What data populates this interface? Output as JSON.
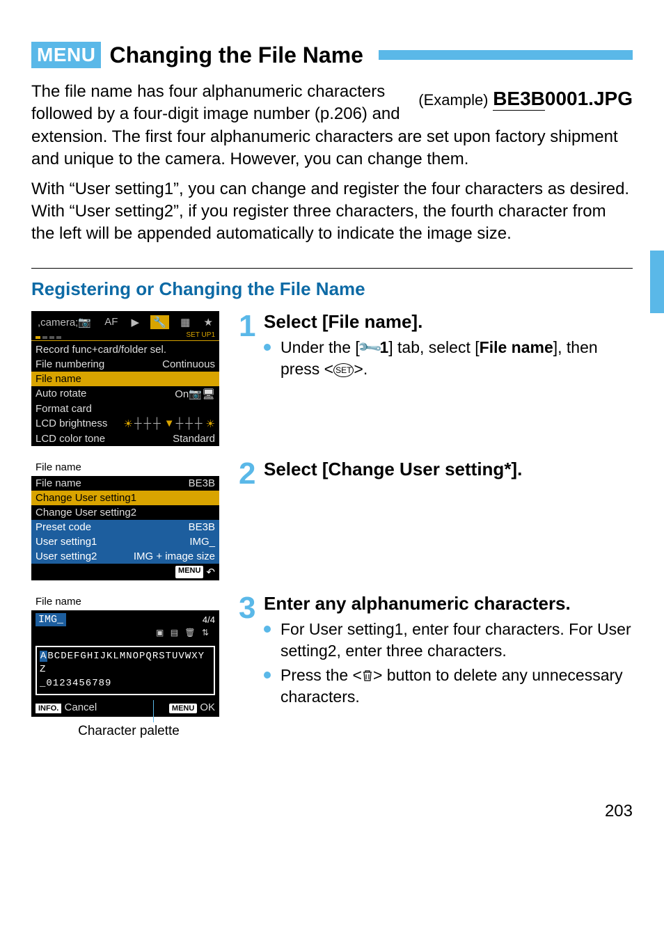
{
  "header": {
    "menu_badge": "MENU",
    "title": "Changing the File Name"
  },
  "intro": {
    "text": "The file name has four alphanumeric characters followed by a four-digit image number (p.206) and extension. The first four alphanumeric characters are set upon factory shipment and unique to the camera. However, you can change them.",
    "text2": "With “User setting1”, you can change and register the four characters as desired. With “User setting2”, if you register three characters, the fourth character from the left will be appended automatically to indicate the image size.",
    "example_label": "(Example)",
    "example_prefix": "BE3B",
    "example_rest": "0001.JPG"
  },
  "subheading": "Registering or Changing the File Name",
  "steps": [
    {
      "num": "1",
      "title": "Select [File name].",
      "bullets": [
        {
          "pre": "Under the [",
          "icon": "wrench",
          "mid": "1",
          "post": "] tab, select [",
          "bold": "File name",
          "tail": "], then press <",
          "icon2": "set",
          "tail2": ">."
        }
      ]
    },
    {
      "num": "2",
      "title": "Select [Change User setting*]."
    },
    {
      "num": "3",
      "title": "Enter any alphanumeric characters.",
      "bullets": [
        {
          "text": "For User setting1, enter four characters. For User setting2, enter three characters."
        },
        {
          "pre": "Press the <",
          "icon": "trash",
          "post": "> button to delete any unnecessary characters."
        }
      ]
    }
  ],
  "cam1": {
    "setup_label": "SET UP1",
    "tabs": [
      "AF"
    ],
    "rows": [
      {
        "l": "Record func+card/folder sel.",
        "r": ""
      },
      {
        "l": "File numbering",
        "r": "Continuous"
      },
      {
        "l": "File name",
        "r": "",
        "sel": true
      },
      {
        "l": "Auto rotate",
        "r": "On📷🖥"
      },
      {
        "l": "Format card",
        "r": ""
      },
      {
        "l": "LCD brightness",
        "r": "slider"
      },
      {
        "l": "LCD color tone",
        "r": "Standard"
      }
    ]
  },
  "cam2": {
    "title": "File name",
    "rows": [
      {
        "l": "File name",
        "r": "BE3B"
      },
      {
        "l": "Change User setting1",
        "r": "",
        "sel": true
      },
      {
        "l": "Change User setting2",
        "r": ""
      },
      {
        "l": "Preset code",
        "r": "BE3B",
        "blue": true
      },
      {
        "l": "User setting1",
        "r": "IMG_",
        "blue": true
      },
      {
        "l": "User setting2",
        "r": "IMG + image size",
        "blue": true
      }
    ],
    "menu_back": "MENU"
  },
  "cam3": {
    "title": "File name",
    "value": "IMG_",
    "count": "4/4",
    "palette_line1_first": "A",
    "palette_line1_rest": "BCDEFGHIJKLMNOPQRSTUVWXYZ",
    "palette_line2": "_0123456789",
    "cancel_badge": "INFO.",
    "cancel_text": "Cancel",
    "ok_badge": "MENU",
    "ok_text": "OK"
  },
  "caption3": "Character palette",
  "page_number": "203"
}
